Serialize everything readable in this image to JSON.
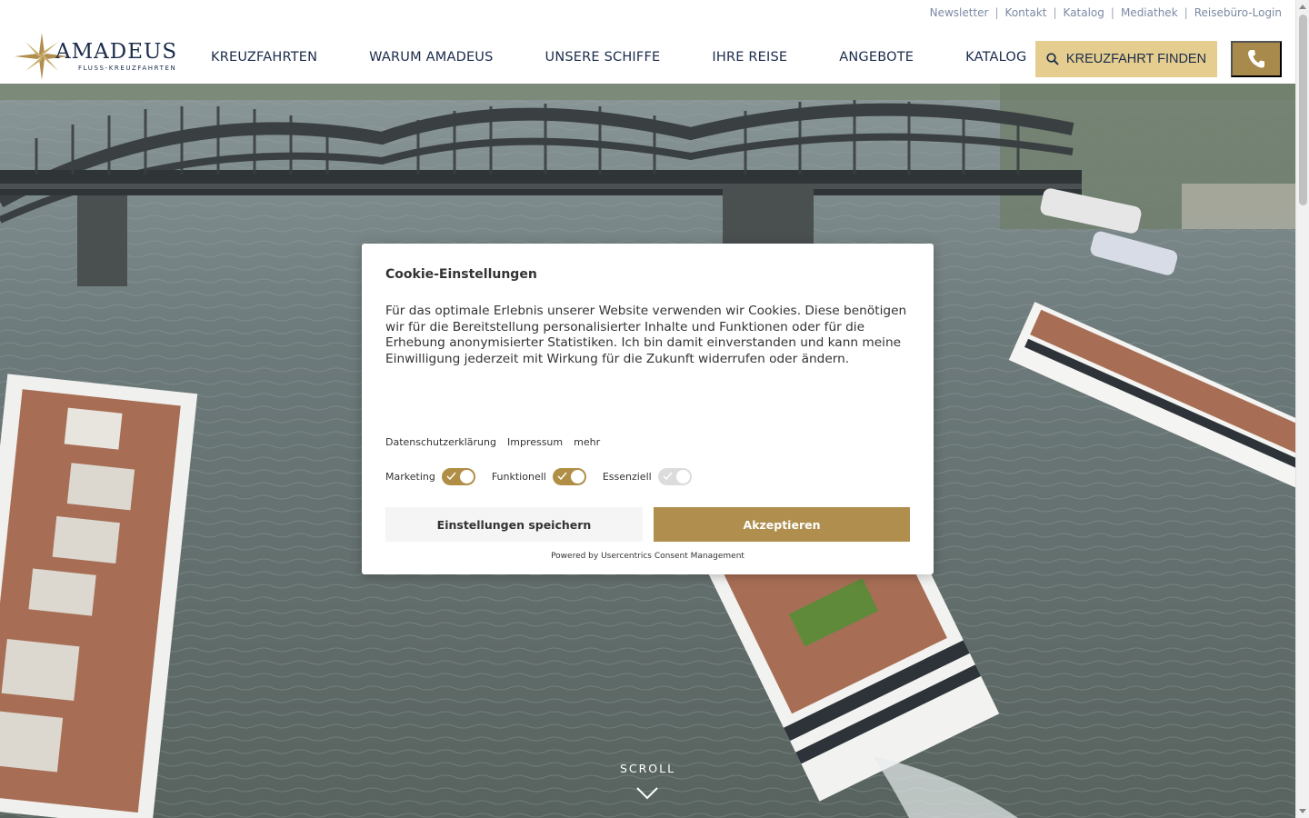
{
  "utility_nav": [
    "Newsletter",
    "Kontakt",
    "Katalog",
    "Mediathek",
    "Reisebüro-Login"
  ],
  "logo": {
    "name": "AMADEUS",
    "tagline": "FLUSS-KREUZFAHRTEN"
  },
  "main_nav": [
    "KREUZFAHRTEN",
    "WARUM AMADEUS",
    "UNSERE SCHIFFE",
    "IHRE REISE",
    "ANGEBOTE",
    "KATALOG"
  ],
  "find_button": {
    "label": "KREUZFAHRT FINDEN",
    "icon": "search-icon"
  },
  "phone_button": {
    "icon": "phone-icon"
  },
  "hero": {
    "scroll_label": "SCROLL",
    "arrow_icon": "chevron-down-icon"
  },
  "cookie": {
    "title": "Cookie-Einstellungen",
    "text": "Für das optimale Erlebnis unserer Website verwenden wir Cookies. Diese benötigen wir für die Bereitstellung personalisierter Inhalte und Funktionen oder für die Erhebung anonymisierter Statistiken. Ich bin damit einverstanden und kann meine Einwilligung jederzeit mit Wirkung für die Zukunft widerrufen oder ändern.",
    "links": [
      "Datenschutzerklärung",
      "Impressum",
      "mehr"
    ],
    "toggles": [
      {
        "label": "Marketing",
        "state": "on"
      },
      {
        "label": "Funktionell",
        "state": "on"
      },
      {
        "label": "Essenziell",
        "state": "disabled"
      }
    ],
    "save_label": "Einstellungen speichern",
    "accept_label": "Akzeptieren",
    "powered": "Powered by Usercentrics Consent Management"
  },
  "colors": {
    "brand_navy": "#1b2b4b",
    "gold": "#b08e4e",
    "light_gold": "#e4cd8e"
  }
}
